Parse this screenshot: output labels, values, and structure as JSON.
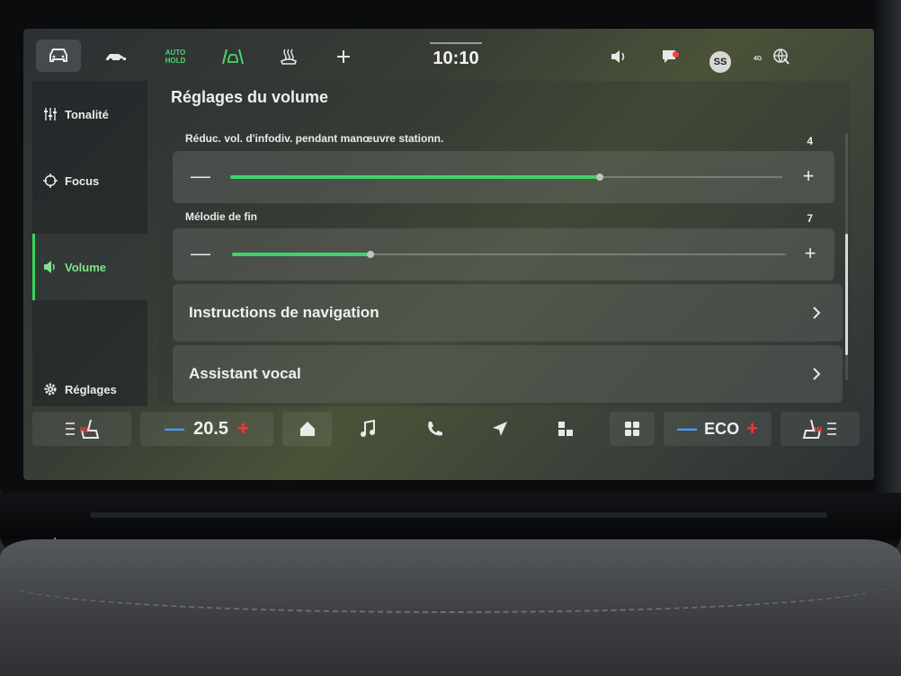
{
  "topbar": {
    "auto_hold_line1": "AUTO",
    "auto_hold_line2": "HOLD",
    "clock": "10:10",
    "profile_initials": "SS",
    "signal": "4G"
  },
  "sidebar": {
    "items": [
      {
        "label": "Tonalité",
        "icon": "equalizer-icon"
      },
      {
        "label": "Focus",
        "icon": "focus-target-icon"
      },
      {
        "label": "Volume",
        "icon": "speaker-icon",
        "active": true
      },
      {
        "label": "Réglages",
        "icon": "gear-icon"
      }
    ]
  },
  "main": {
    "title": "Réglages du volume",
    "sliders": [
      {
        "label": "Réduc. vol. d'infodiv. pendant manœuvre stationn.",
        "value": "4",
        "fill_fraction": 0.67
      },
      {
        "label": "Mélodie de fin",
        "value": "7",
        "fill_fraction": 0.25
      }
    ],
    "links": [
      {
        "label": "Instructions de navigation"
      },
      {
        "label": "Assistant vocal"
      }
    ],
    "minus_symbol": "—",
    "plus_symbol": "+"
  },
  "bottombar": {
    "temperature": "20.5",
    "drive_mode": "ECO",
    "minus_symbol": "—",
    "plus_symbol": "+"
  },
  "colors": {
    "accent_green": "#3fd36b",
    "minus_blue": "#3fa3ff",
    "plus_red": "#ff3131"
  }
}
